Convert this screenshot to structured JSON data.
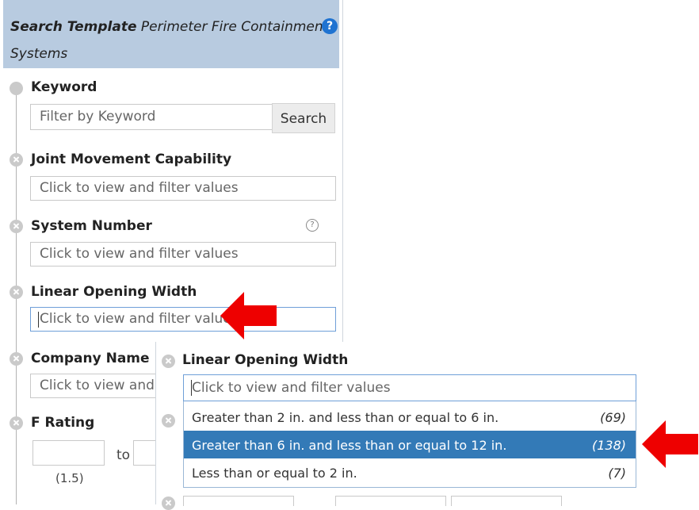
{
  "header": {
    "title_bold": "Search Template",
    "title_rest": "Perimeter Fire Containment",
    "title_line2": "Systems",
    "help_icon": "?"
  },
  "keyword": {
    "label": "Keyword",
    "placeholder": "Filter by Keyword",
    "search_label": "Search"
  },
  "joint_movement": {
    "label": "Joint Movement Capability",
    "placeholder": "Click to view and filter values"
  },
  "system_number": {
    "label": "System Number",
    "placeholder": "Click to view and filter values",
    "help_icon": "?"
  },
  "linear_opening": {
    "label": "Linear Opening Width",
    "placeholder": "Click to view and filter values"
  },
  "company_name": {
    "label": "Company Name",
    "placeholder": "Click to view and filter values"
  },
  "f_rating": {
    "label": "F Rating",
    "to": "to",
    "min_hint": "(1.5)"
  },
  "popup": {
    "label": "Linear Opening Width",
    "placeholder": "Click to view and filter values",
    "options": [
      {
        "label": "Greater than 2 in. and less than or equal to 6 in.",
        "count": "(69)"
      },
      {
        "label": "Greater than 6 in. and less than or equal to 12 in.",
        "count": "(138)"
      },
      {
        "label": "Less than or equal to 2 in.",
        "count": "(7)"
      }
    ],
    "selected_index": 1,
    "partial_label": "F Rating"
  },
  "colors": {
    "header_bg": "#b8cbe0",
    "accent_blue": "#1f73d1",
    "selected_bg": "#337ab7",
    "arrow": "#ee0000"
  }
}
